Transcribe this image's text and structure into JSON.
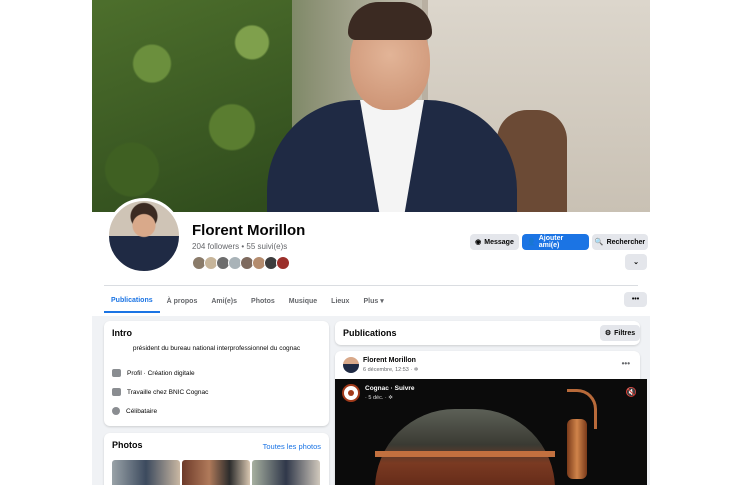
{
  "profile": {
    "name": "Florent Morillon",
    "followers_line": "204 followers • 55 suivi(e)s",
    "friend_colors": [
      "#8a7b6a",
      "#c7b59a",
      "#6d6d6d",
      "#a9b3b8",
      "#7e6a5e",
      "#b48c6e",
      "#3d3d3d",
      "#9b2f2a"
    ]
  },
  "actions": {
    "message": "Message",
    "add_friend": "Ajouter ami(e)",
    "search": "Rechercher",
    "more_icon": "chevron-down-icon"
  },
  "tabs": [
    {
      "label": "Publications",
      "active": true
    },
    {
      "label": "À propos",
      "active": false
    },
    {
      "label": "Ami(e)s",
      "active": false
    },
    {
      "label": "Photos",
      "active": false
    },
    {
      "label": "Musique",
      "active": false
    },
    {
      "label": "Lieux",
      "active": false
    },
    {
      "label": "Plus ▾",
      "active": false
    }
  ],
  "tabs_more_icon": "ellipsis-icon",
  "intro": {
    "title": "Intro",
    "bio": "président du bureau national interprofessionnel du cognac",
    "rows": [
      {
        "icon": "briefcase-icon",
        "text": "Profil · Création digitale"
      },
      {
        "icon": "work-icon",
        "text": "Travaille chez BNIC Cognac"
      },
      {
        "icon": "heart-icon",
        "text": "Célibataire"
      }
    ]
  },
  "photos": {
    "title": "Photos",
    "link": "Toutes les photos"
  },
  "publications": {
    "title": "Publications",
    "filter": "Filtres"
  },
  "post": {
    "author": "Florent Morillon",
    "date": "6 décembre, 12:53 · ✲",
    "video": {
      "page": "Cognac · Suivre",
      "time": "· 5 déc. · ✲",
      "mute_icon": "mute-icon"
    }
  },
  "colors": {
    "accent": "#1b74e4",
    "background": "#f0f2f5",
    "card": "#ffffff",
    "muted_text": "#65676b"
  }
}
